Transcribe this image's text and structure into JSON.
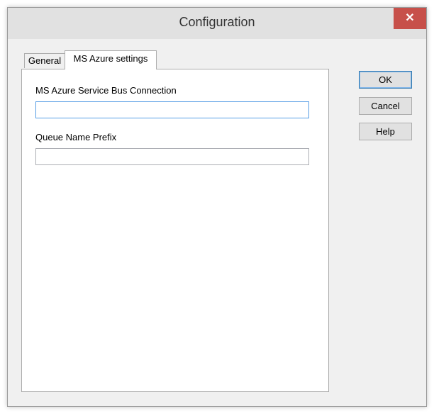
{
  "window": {
    "title": "Configuration",
    "close_glyph": "✕"
  },
  "tabs": [
    {
      "label": "General",
      "selected": false
    },
    {
      "label": "MS Azure settings",
      "selected": true
    }
  ],
  "form": {
    "service_bus_connection": {
      "label": "MS Azure Service Bus Connection",
      "value": "",
      "focused": true
    },
    "queue_name_prefix": {
      "label": "Queue Name Prefix",
      "value": ""
    }
  },
  "buttons": {
    "ok": "OK",
    "cancel": "Cancel",
    "help": "Help"
  },
  "colors": {
    "close_button": "#c7504a",
    "focus_border": "#569de5"
  }
}
